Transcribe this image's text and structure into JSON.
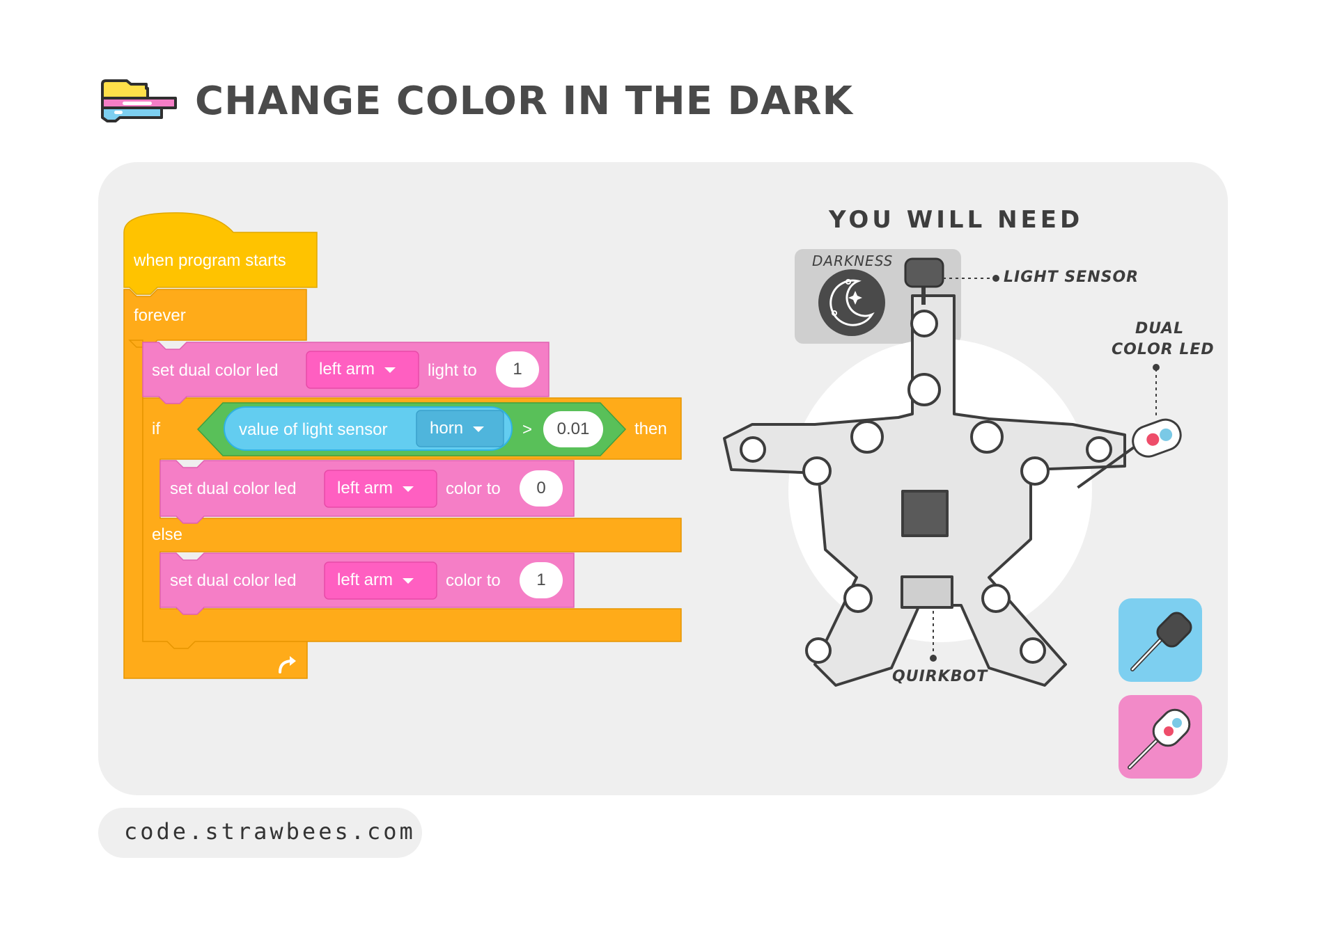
{
  "header": {
    "title": "CHANGE COLOR IN THE DARK",
    "icon": "stacked-blocks-icon"
  },
  "code": {
    "hat_label": "when program starts",
    "forever_label": "forever",
    "set1": {
      "prefix": "set dual color led",
      "dropdown": "left arm",
      "mid": "light to",
      "value": "1"
    },
    "if_label": "if",
    "condition": {
      "sensor_label": "value of light sensor",
      "dropdown": "horn",
      "operator": ">",
      "value": "0.01"
    },
    "then_label": "then",
    "set2": {
      "prefix": "set dual color led",
      "dropdown": "left arm",
      "mid": "color to",
      "value": "0"
    },
    "else_label": "else",
    "set3": {
      "prefix": "set dual color led",
      "dropdown": "left arm",
      "mid": "color to",
      "value": "1"
    },
    "loop_icon": "loop-arrow-icon"
  },
  "needs": {
    "heading": "YOU WILL NEED",
    "darkness_label": "DARKNESS",
    "light_sensor_label": "LIGHT SENSOR",
    "dual_led_label_line1": "DUAL",
    "dual_led_label_line2": "COLOR LED",
    "quirkbot_label": "QUIRKBOT",
    "tiles": [
      {
        "icon": "light-sensor-icon",
        "color": "#7dcff0"
      },
      {
        "icon": "dual-color-led-icon",
        "color": "#f28ac8"
      }
    ]
  },
  "footer": {
    "url": "code.strawbees.com"
  },
  "colors": {
    "event_yellow": "#ffc300",
    "control_orange": "#ffab19",
    "led_pink": "#f57ec6",
    "dropdown_pink": "#ff5fc1",
    "operator_green": "#59c059",
    "sensor_blue": "#63cdf0"
  }
}
